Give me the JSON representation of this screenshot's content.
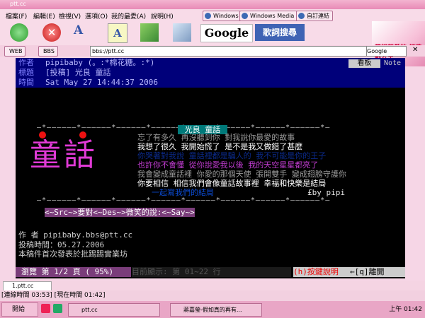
{
  "window": {
    "title": "ptt.cc"
  },
  "menu": [
    "檔案(F)",
    "編輯(E)",
    "檢視(V)",
    "選項(O)",
    "我的最愛(A)",
    "說明(H)"
  ],
  "links": [
    "Windows",
    "Windows Media",
    "自訂連結"
  ],
  "toolbar": {
    "google": "Google",
    "lyrics": "歌詞搜尋"
  },
  "logo": {
    "text": "夢想親愛的 紅遊戲人生"
  },
  "address": {
    "tab1": "WEB",
    "tab2": "BBS",
    "url": "bbs://ptt.cc",
    "search": "Google"
  },
  "article": {
    "labels": [
      "作者",
      "標題",
      "時間"
    ],
    "author": "pipibaby (。:*棉花糖。:*)",
    "title": "[投稿] 光良 童話",
    "time": "Sat May 27 14:44:37 2006",
    "board_label": "看板",
    "board_name": "Note",
    "dash_top": "—*——————*——————*——————*——————*——————*——————*——————*——————*—",
    "song_title": "光良  童話",
    "big_title": "童話",
    "lines": [
      "忘了有多久  再沒聽到你  對我說你最愛的故事",
      "我想了很久  我開始慌了  是不是我又做錯了甚麼",
      "你哭著對我說  童話裡都是騙人的  我不可能是你的王子",
      "也許你不會懂  從你說愛我以後  我的天空星星都亮了",
      "我會變成童話裡  你愛的那個天使  張開雙手  變成翅膀守護你",
      "你要相信  相信我們會像童話故事裡  幸福和快樂是結局",
      "一起寫我們的結局"
    ],
    "by": "£by pipi",
    "dash_bottom": "—*——————*——————*——————*——————*——————*——————*——————*——————*—",
    "sig": "<~Src~>要對<~Des~>微笑的說:<~Say~>",
    "author_email": "作     者 pipibaby.bbs@ptt.cc",
    "post_time": "投稿時間：05.27.2006",
    "note": "本稿件首次發表於批踢踢實業坊",
    "footer_left": "瀏覽 第 1/2 頁 ( 95%)",
    "footer_mid": "目前顯示: 第 01~22 行",
    "footer_help": "(h)按鍵說明",
    "footer_leave": "←[q]離開"
  },
  "tabs": {
    "tab1": "1.ptt.cc"
  },
  "status": "[連線時間 03:53] [現在時間 01:42]",
  "taskbar": {
    "start": "開始",
    "tasks": [
      "ptt.cc",
      "蔣嘉瑩-假如真的再有..."
    ],
    "clock": "上午 01:42"
  }
}
